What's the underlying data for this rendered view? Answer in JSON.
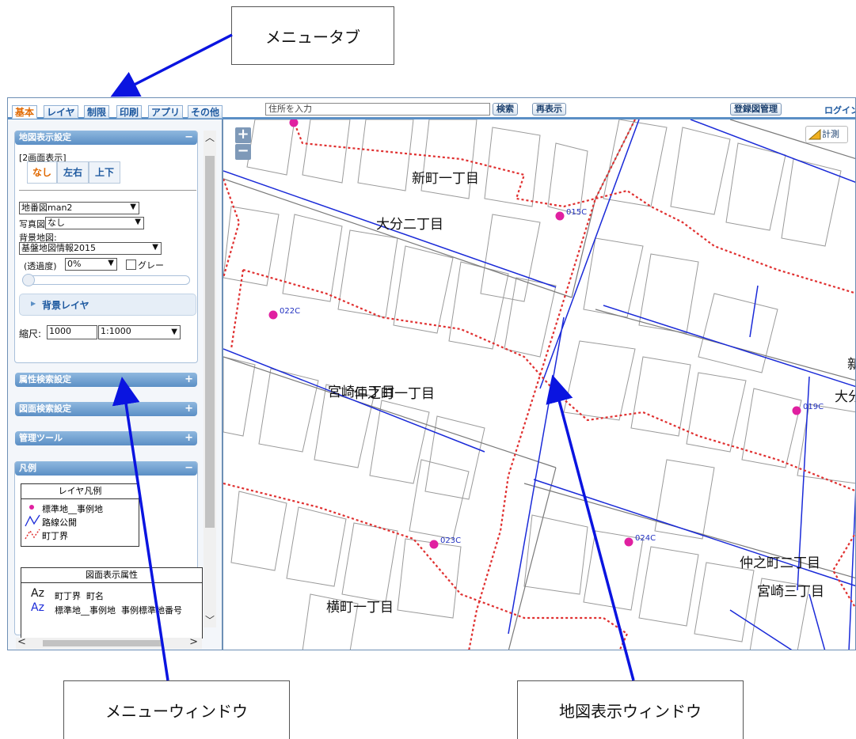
{
  "callouts": {
    "menu_tab": "メニュータブ",
    "menu_window": "メニューウィンドウ",
    "map_window": "地図表示ウィンドウ"
  },
  "tabs": [
    "基本",
    "レイヤ",
    "制限",
    "印刷",
    "アプリ",
    "その他"
  ],
  "toolbar": {
    "address_placeholder": "住所を入力",
    "search": "検索",
    "redisplay": "再表示",
    "registered_map_manage": "登録図管理",
    "login": "ログイン"
  },
  "menu": {
    "map_display_settings": "地図表示設定",
    "dual_screen_label": "[2画面表示]",
    "dual_options": [
      "なし",
      "左右",
      "上下"
    ],
    "base_map_select": "地番図man2",
    "photo_label": "写真図:",
    "photo_select": "なし",
    "background_label": "背景地図:",
    "background_select": "基盤地図情報2015",
    "opacity_label": "(透過度)",
    "opacity_value": "0%",
    "gray_label": "グレー",
    "background_layer": "背景レイヤ",
    "scale_label": "縮尺:",
    "scale_input": "1000",
    "scale_select": "1:1000",
    "attr_search": "属性検索設定",
    "map_search": "図面検索設定",
    "admin_tools": "管理ツール",
    "legend_header": "凡例",
    "layer_legend_title": "レイヤ凡例",
    "legend_items": [
      "標準地__事例地",
      "路線公開",
      "町丁界"
    ],
    "display_attr_title": "図面表示属性",
    "attr_rows": [
      "町丁界  町名",
      "標準地__事例地  事例標準地番号"
    ]
  },
  "map": {
    "measure": "計測",
    "zoom_in": "+",
    "zoom_out": "−",
    "district_labels": [
      "新町一丁目",
      "大分二丁目",
      "宮崎二丁目",
      "仲之町一丁目",
      "仲之町二丁目",
      "宮崎三丁目",
      "横町一丁目",
      "新",
      "大分"
    ],
    "points": [
      "015C",
      "022C",
      "019C",
      "024C",
      "023C"
    ]
  },
  "colors": {
    "accent": "#5b8fc5",
    "boundary": "#e03030",
    "route": "#1a2ad8",
    "point": "#e020a0",
    "arrow": "#0a14e0"
  }
}
